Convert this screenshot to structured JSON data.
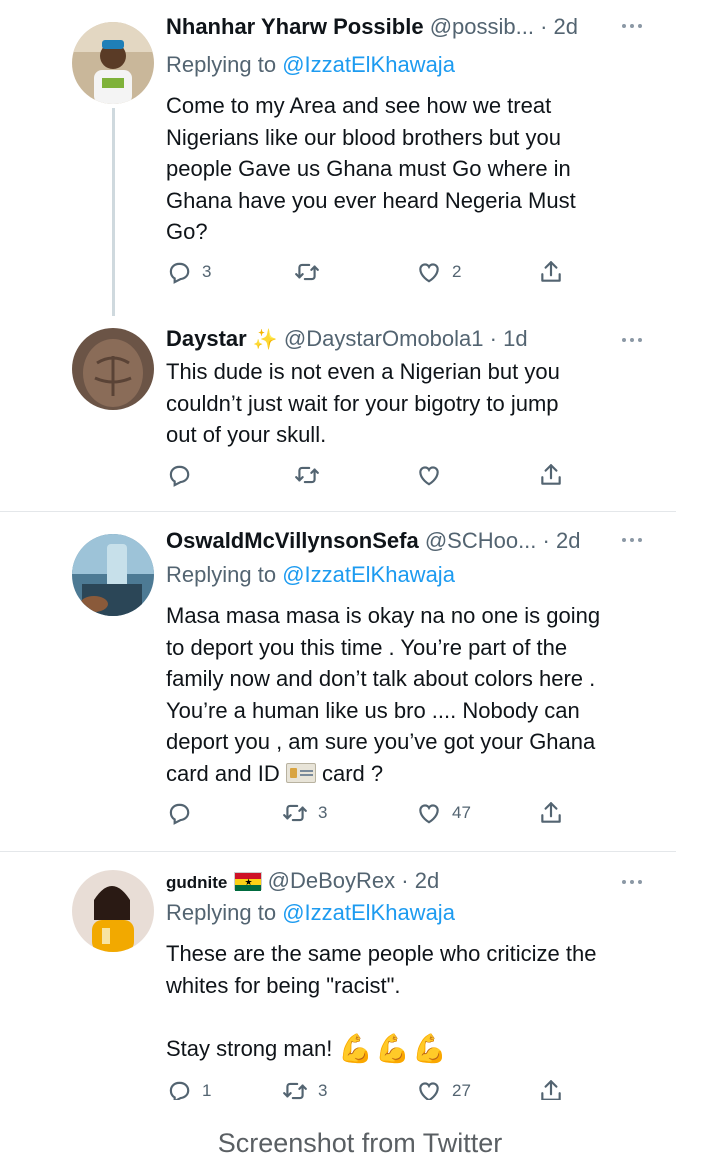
{
  "tweets": [
    {
      "name": "Nhanhar Yharw Possible",
      "handle": "@possib...",
      "time": "· 2d",
      "replying_prefix": "Replying to ",
      "replying_to": "@IzzatElKhawaja",
      "text": "Come to my Area and  see how we treat\nNigerians like our blood brothers but you\npeople Gave us Ghana must Go where in\nGhana have you ever heard Negeria Must\nGo?",
      "replies": "3",
      "retweets": "",
      "likes": "2"
    },
    {
      "name": "Daystar",
      "badge": "sparkles-emoji",
      "handle": "@DaystarOmobola1",
      "time": "· 1d",
      "text": "This dude is not even a Nigerian but you\ncouldn’t just wait for your bigotry to jump\nout of your skull.",
      "replies": "",
      "retweets": "",
      "likes": ""
    },
    {
      "name": "OswaldMcVillynsonSefa",
      "handle": "@SCHoo...",
      "time": "· 2d",
      "replying_prefix": "Replying to ",
      "replying_to": "@IzzatElKhawaja",
      "text_part1": "Masa masa masa is okay na no one is going\nto deport you this time . You’re part of the\nfamily now and don’t talk about colors here .\nYou’re a human like us bro .... Nobody can\ndeport you , am sure you’ve got your Ghana\ncard and ID ",
      "inline_icon": "id-card-emoji",
      "text_part2": " card ?",
      "replies": "",
      "retweets": "3",
      "likes": "47"
    },
    {
      "name": "gudnite",
      "badge": "ghana-flag-emoji",
      "handle": "@DeBoyRex",
      "time": "· 2d",
      "replying_prefix": "Replying to ",
      "replying_to": "@IzzatElKhawaja",
      "text": "These are the same people who criticize the\nwhites for being \"racist\".",
      "text2": "Stay strong man! ",
      "emoji": "flexed-biceps-emoji",
      "replies": "1",
      "retweets": "3",
      "likes": "27"
    }
  ],
  "icons": {
    "reply": "reply-icon",
    "retweet": "retweet-icon",
    "like": "heart-icon",
    "share": "share-icon",
    "more": "more-options-icon"
  },
  "colors": {
    "link": "#1d9bf0",
    "secondary_text": "#536471",
    "primary_text": "#0f1419",
    "divider": "#e4e7ea"
  },
  "caption": "Screenshot from Twitter"
}
